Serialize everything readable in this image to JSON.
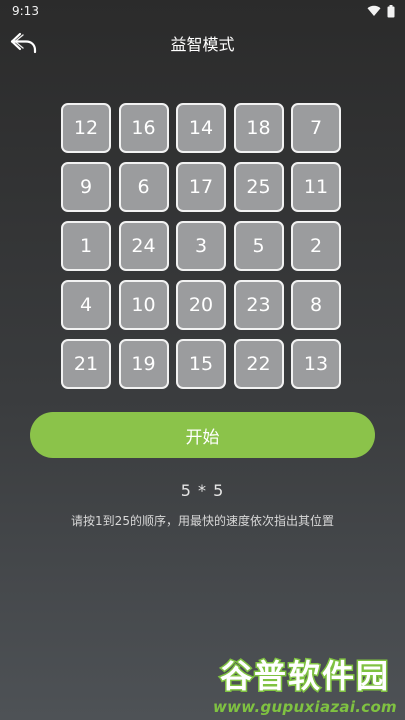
{
  "status_bar": {
    "time": "9:13"
  },
  "app_bar": {
    "title": "益智模式",
    "back_icon": "back-arrow-icon"
  },
  "grid": {
    "rows": [
      [
        "12",
        "16",
        "14",
        "18",
        "7"
      ],
      [
        "9",
        "6",
        "17",
        "25",
        "11"
      ],
      [
        "1",
        "24",
        "3",
        "5",
        "2"
      ],
      [
        "4",
        "10",
        "20",
        "23",
        "8"
      ],
      [
        "21",
        "19",
        "15",
        "22",
        "13"
      ]
    ]
  },
  "start_button": {
    "label": "开始"
  },
  "info": {
    "grid_size": "5 * 5",
    "instruction": "请按1到25的顺序，用最快的速度依次指出其位置"
  },
  "watermark": {
    "logo_text": "谷普软件园",
    "url": "www.gupuxiazai.com"
  },
  "colors": {
    "accent": "#8bc34a",
    "cell_fill": "#9b9c9e",
    "cell_border": "#f2f2f2"
  }
}
